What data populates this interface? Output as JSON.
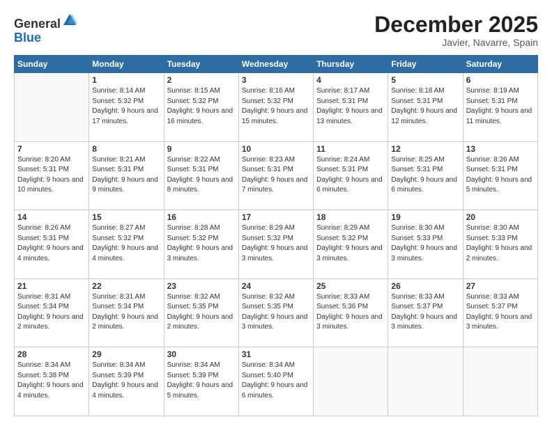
{
  "logo": {
    "general": "General",
    "blue": "Blue"
  },
  "header": {
    "month": "December 2025",
    "location": "Javier, Navarre, Spain"
  },
  "days_of_week": [
    "Sunday",
    "Monday",
    "Tuesday",
    "Wednesday",
    "Thursday",
    "Friday",
    "Saturday"
  ],
  "weeks": [
    [
      {
        "day": null,
        "info": null
      },
      {
        "day": "1",
        "sunrise": "8:14 AM",
        "sunset": "5:32 PM",
        "daylight": "9 hours and 17 minutes."
      },
      {
        "day": "2",
        "sunrise": "8:15 AM",
        "sunset": "5:32 PM",
        "daylight": "9 hours and 16 minutes."
      },
      {
        "day": "3",
        "sunrise": "8:16 AM",
        "sunset": "5:32 PM",
        "daylight": "9 hours and 15 minutes."
      },
      {
        "day": "4",
        "sunrise": "8:17 AM",
        "sunset": "5:31 PM",
        "daylight": "9 hours and 13 minutes."
      },
      {
        "day": "5",
        "sunrise": "8:18 AM",
        "sunset": "5:31 PM",
        "daylight": "9 hours and 12 minutes."
      },
      {
        "day": "6",
        "sunrise": "8:19 AM",
        "sunset": "5:31 PM",
        "daylight": "9 hours and 11 minutes."
      }
    ],
    [
      {
        "day": "7",
        "sunrise": "8:20 AM",
        "sunset": "5:31 PM",
        "daylight": "9 hours and 10 minutes."
      },
      {
        "day": "8",
        "sunrise": "8:21 AM",
        "sunset": "5:31 PM",
        "daylight": "9 hours and 9 minutes."
      },
      {
        "day": "9",
        "sunrise": "8:22 AM",
        "sunset": "5:31 PM",
        "daylight": "9 hours and 8 minutes."
      },
      {
        "day": "10",
        "sunrise": "8:23 AM",
        "sunset": "5:31 PM",
        "daylight": "9 hours and 7 minutes."
      },
      {
        "day": "11",
        "sunrise": "8:24 AM",
        "sunset": "5:31 PM",
        "daylight": "9 hours and 6 minutes."
      },
      {
        "day": "12",
        "sunrise": "8:25 AM",
        "sunset": "5:31 PM",
        "daylight": "9 hours and 6 minutes."
      },
      {
        "day": "13",
        "sunrise": "8:26 AM",
        "sunset": "5:31 PM",
        "daylight": "9 hours and 5 minutes."
      }
    ],
    [
      {
        "day": "14",
        "sunrise": "8:26 AM",
        "sunset": "5:31 PM",
        "daylight": "9 hours and 4 minutes."
      },
      {
        "day": "15",
        "sunrise": "8:27 AM",
        "sunset": "5:32 PM",
        "daylight": "9 hours and 4 minutes."
      },
      {
        "day": "16",
        "sunrise": "8:28 AM",
        "sunset": "5:32 PM",
        "daylight": "9 hours and 3 minutes."
      },
      {
        "day": "17",
        "sunrise": "8:29 AM",
        "sunset": "5:32 PM",
        "daylight": "9 hours and 3 minutes."
      },
      {
        "day": "18",
        "sunrise": "8:29 AM",
        "sunset": "5:32 PM",
        "daylight": "9 hours and 3 minutes."
      },
      {
        "day": "19",
        "sunrise": "8:30 AM",
        "sunset": "5:33 PM",
        "daylight": "9 hours and 3 minutes."
      },
      {
        "day": "20",
        "sunrise": "8:30 AM",
        "sunset": "5:33 PM",
        "daylight": "9 hours and 2 minutes."
      }
    ],
    [
      {
        "day": "21",
        "sunrise": "8:31 AM",
        "sunset": "5:34 PM",
        "daylight": "9 hours and 2 minutes."
      },
      {
        "day": "22",
        "sunrise": "8:31 AM",
        "sunset": "5:34 PM",
        "daylight": "9 hours and 2 minutes."
      },
      {
        "day": "23",
        "sunrise": "8:32 AM",
        "sunset": "5:35 PM",
        "daylight": "9 hours and 2 minutes."
      },
      {
        "day": "24",
        "sunrise": "8:32 AM",
        "sunset": "5:35 PM",
        "daylight": "9 hours and 3 minutes."
      },
      {
        "day": "25",
        "sunrise": "8:33 AM",
        "sunset": "5:36 PM",
        "daylight": "9 hours and 3 minutes."
      },
      {
        "day": "26",
        "sunrise": "8:33 AM",
        "sunset": "5:37 PM",
        "daylight": "9 hours and 3 minutes."
      },
      {
        "day": "27",
        "sunrise": "8:33 AM",
        "sunset": "5:37 PM",
        "daylight": "9 hours and 3 minutes."
      }
    ],
    [
      {
        "day": "28",
        "sunrise": "8:34 AM",
        "sunset": "5:38 PM",
        "daylight": "9 hours and 4 minutes."
      },
      {
        "day": "29",
        "sunrise": "8:34 AM",
        "sunset": "5:39 PM",
        "daylight": "9 hours and 4 minutes."
      },
      {
        "day": "30",
        "sunrise": "8:34 AM",
        "sunset": "5:39 PM",
        "daylight": "9 hours and 5 minutes."
      },
      {
        "day": "31",
        "sunrise": "8:34 AM",
        "sunset": "5:40 PM",
        "daylight": "9 hours and 6 minutes."
      },
      {
        "day": null,
        "info": null
      },
      {
        "day": null,
        "info": null
      },
      {
        "day": null,
        "info": null
      }
    ]
  ],
  "labels": {
    "sunrise": "Sunrise:",
    "sunset": "Sunset:",
    "daylight": "Daylight:"
  }
}
